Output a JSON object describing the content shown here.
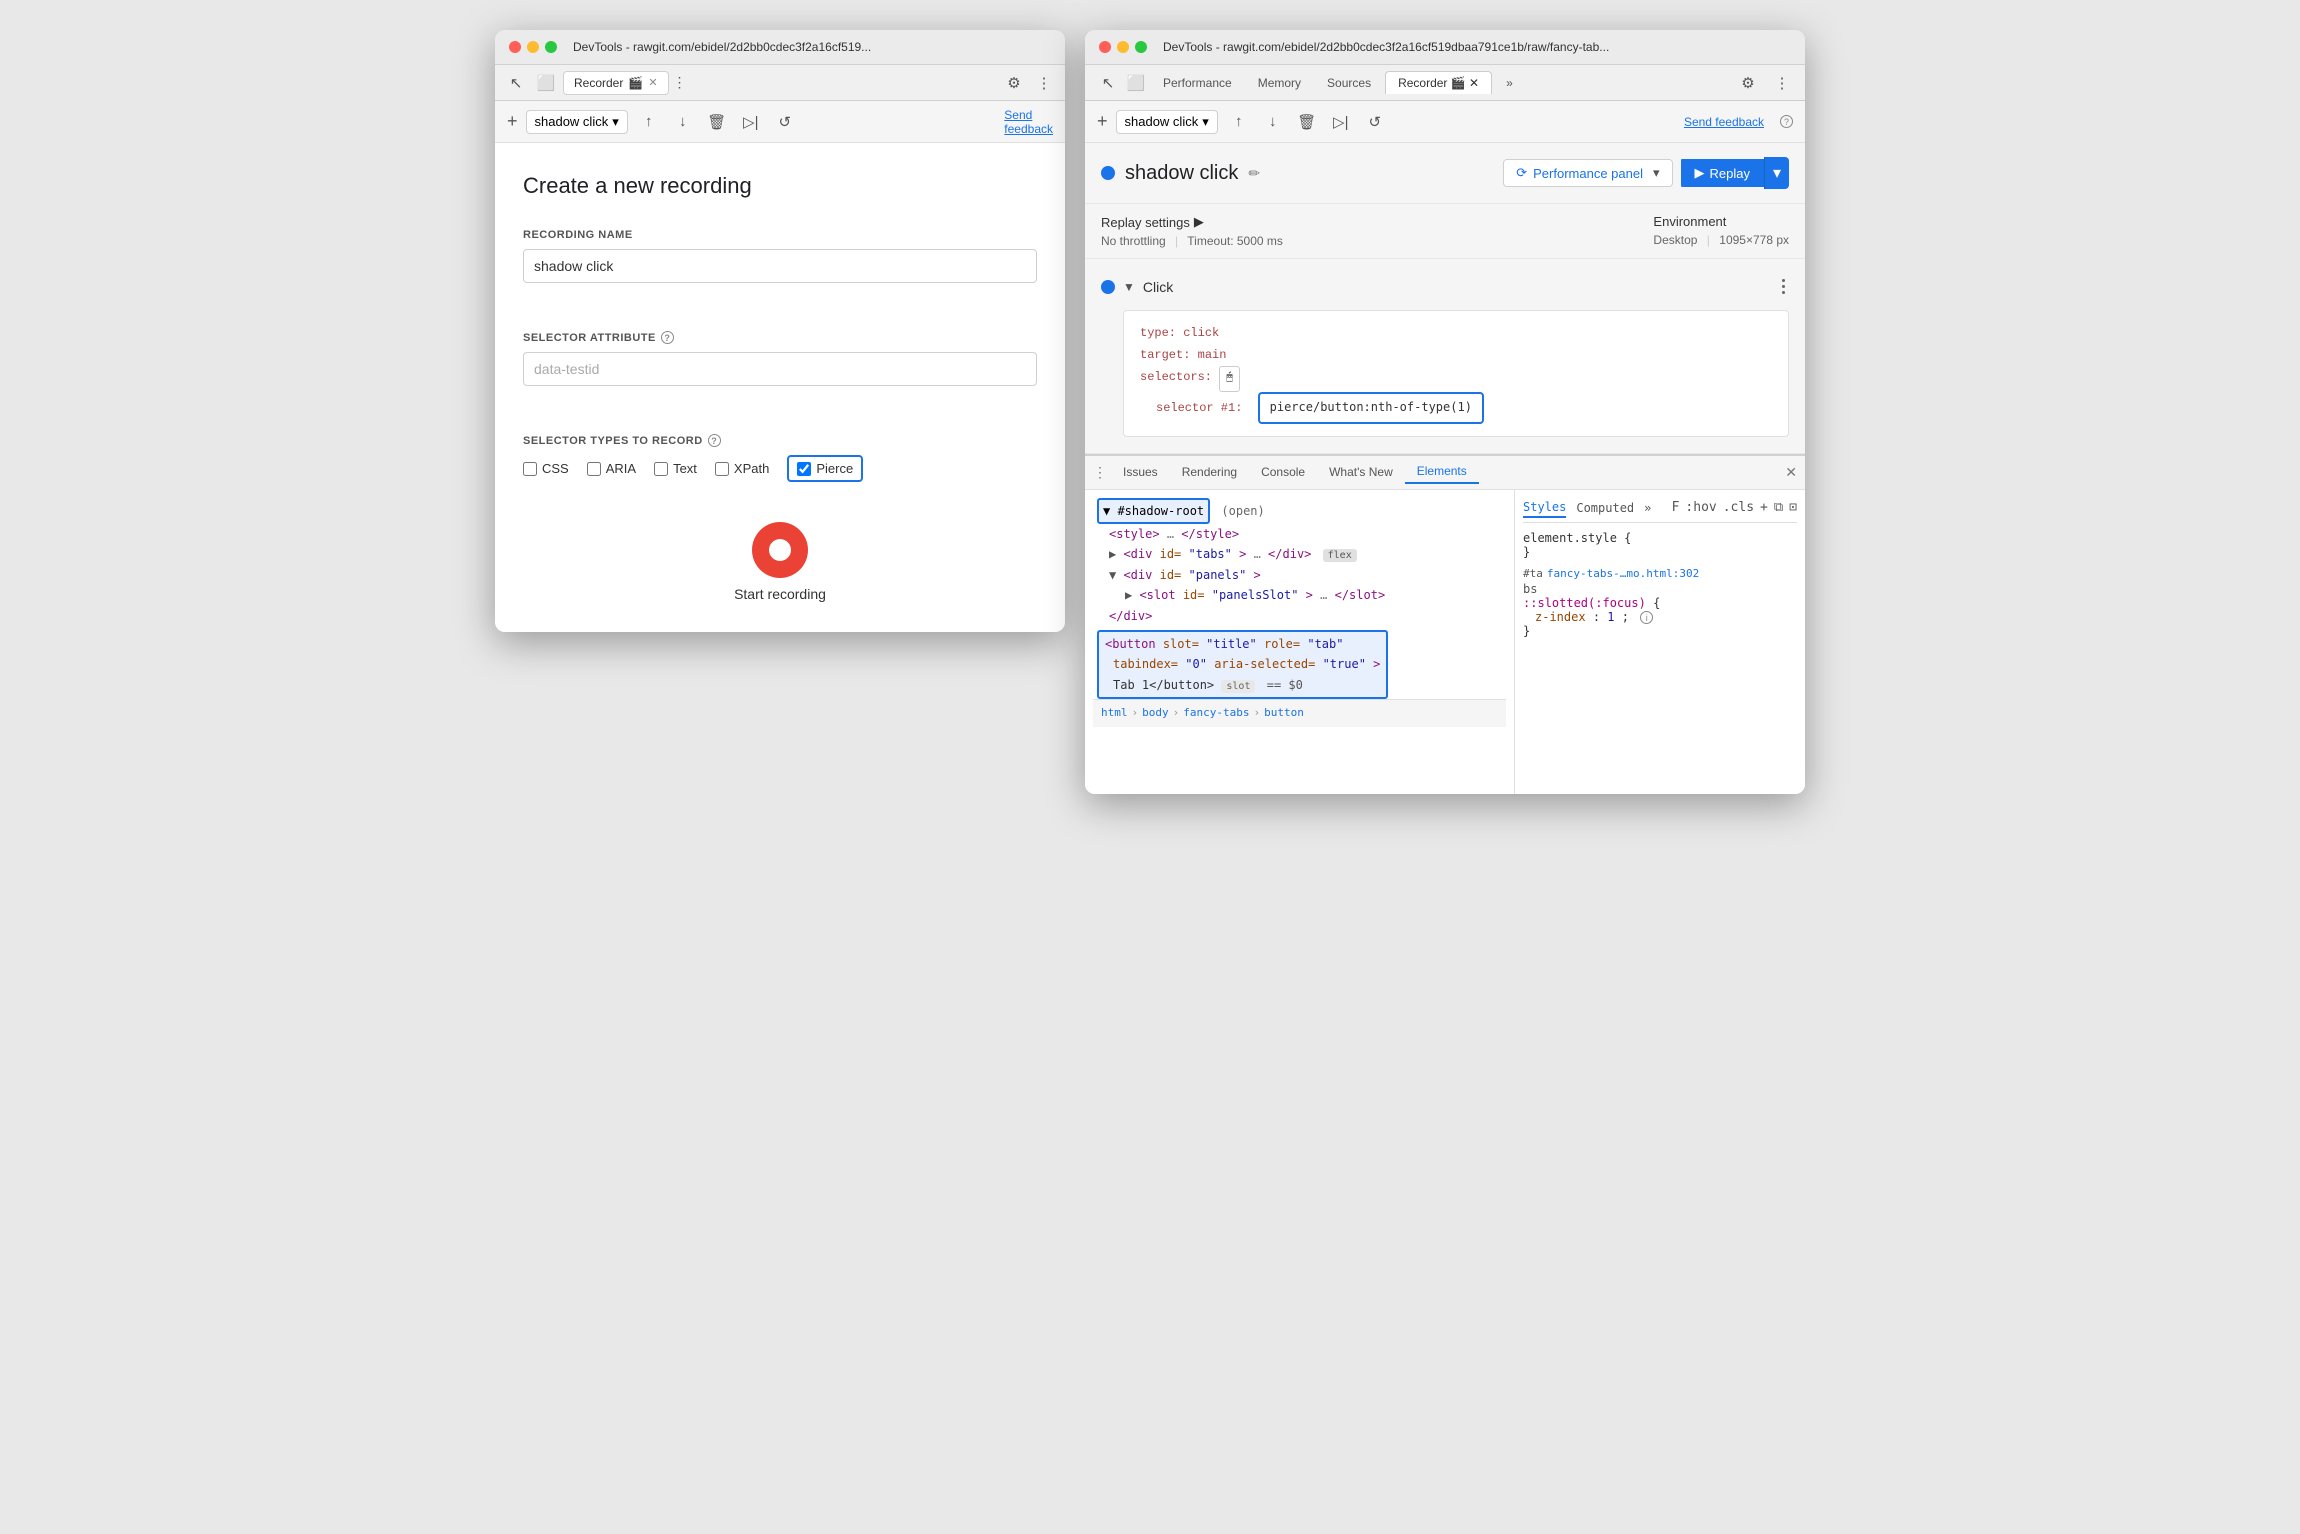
{
  "left_window": {
    "title": "DevTools - rawgit.com/ebidel/2d2bb0cdec3f2a16cf519...",
    "tab_label": "Recorder",
    "tab_icon": "🎬",
    "settings_icon": "⚙",
    "more_icon": "⋮",
    "toolbar": {
      "add_icon": "+",
      "recording_name": "shadow click",
      "dropdown_icon": "▾",
      "export_icon": "↑",
      "import_icon": "↓",
      "delete_icon": "🗑",
      "step_play_icon": "▷|",
      "replay_icon": "↺",
      "send_feedback": "Send feedback"
    },
    "form": {
      "create_title": "Create a new recording",
      "recording_name_label": "RECORDING NAME",
      "recording_name_value": "shadow click",
      "selector_attribute_label": "SELECTOR ATTRIBUTE",
      "selector_attribute_help": "?",
      "selector_attribute_placeholder": "data-testid",
      "selector_types_label": "SELECTOR TYPES TO RECORD",
      "selector_types_help": "?",
      "checkboxes": [
        {
          "id": "css",
          "label": "CSS",
          "checked": false
        },
        {
          "id": "aria",
          "label": "ARIA",
          "checked": false
        },
        {
          "id": "text",
          "label": "Text",
          "checked": false
        },
        {
          "id": "xpath",
          "label": "XPath",
          "checked": false
        },
        {
          "id": "pierce",
          "label": "Pierce",
          "checked": true
        }
      ],
      "start_recording_label": "Start recording"
    }
  },
  "right_window": {
    "title": "DevTools - rawgit.com/ebidel/2d2bb0cdec3f2a16cf519dbaa791ce1b/raw/fancy-tab...",
    "top_tabs": [
      "Performance",
      "Memory",
      "Sources",
      "Recorder",
      "»"
    ],
    "active_top_tab": "Recorder",
    "settings_icon": "⚙",
    "more_icon": "⋮",
    "toolbar": {
      "add_icon": "+",
      "recording_name": "shadow click",
      "dropdown_icon": "▾",
      "export_icon": "↑",
      "import_icon": "↓",
      "delete_icon": "🗑",
      "step_play_icon": "▷|",
      "replay_icon": "↺",
      "send_feedback": "Send feedback",
      "help_icon": "?"
    },
    "recording_header": {
      "status_color": "#1a73e8",
      "title": "shadow click",
      "edit_icon": "✏",
      "performance_panel_label": "Performance panel",
      "perf_dropdown_icon": "▾",
      "replay_label": "Replay",
      "replay_dropdown_icon": "▾"
    },
    "replay_settings": {
      "title": "Replay settings",
      "expand_icon": "▶",
      "throttling": "No throttling",
      "separator": "|",
      "timeout": "Timeout: 5000 ms",
      "environment_title": "Environment",
      "environment_value": "Desktop",
      "resolution": "1095×778 px"
    },
    "step": {
      "title": "Click",
      "more_icon": "⋮",
      "code": {
        "type_key": "type:",
        "type_val": "click",
        "target_key": "target:",
        "target_val": "main",
        "selectors_key": "selectors:",
        "selector_icon": "🖱",
        "selector_num_label": "selector #1:",
        "selector_value": "pierce/button:nth-of-type(1)"
      }
    },
    "bottom_panel": {
      "tabs": [
        "Issues",
        "Rendering",
        "Console",
        "What's New",
        "Elements"
      ],
      "active_tab": "Elements",
      "html_tree": {
        "shadow_root_text": "#shadow-root",
        "open_text": "(open)",
        "style_line": "<style>…</style>",
        "div_tabs": "<div id=\"tabs\">…</div>",
        "flex_badge": "flex",
        "div_panels": "<div id=\"panels\">",
        "slot_panels": "<slot id=\"panelsSlot\">…</slot>",
        "div_close": "</div>",
        "button_line1": "<button slot=\"title\" role=\"tab\"",
        "button_line2": "tabindex=\"0\" aria-selected=\"true\">",
        "button_line3": "Tab 1</button>",
        "slot_badge": "slot",
        "eq_text": "== $0"
      },
      "breadcrumbs": [
        "html",
        "body",
        "fancy-tabs",
        "button"
      ],
      "styles_panel": {
        "tabs": [
          "Styles",
          "Computed"
        ],
        "more_icon": "»",
        "filter_placeholder": "F",
        "hov_label": ":hov",
        "cls_label": ".cls",
        "add_rule_icon": "+",
        "element_style": {
          "selector": "element.style {",
          "close": "}"
        },
        "rule1": {
          "source": "#ta  fancy-tabs-…mo.html:302",
          "selector": "bs",
          "property": "::slotted(:focus) {",
          "prop_name": "z-index:",
          "prop_val": "1;"
        }
      }
    }
  }
}
